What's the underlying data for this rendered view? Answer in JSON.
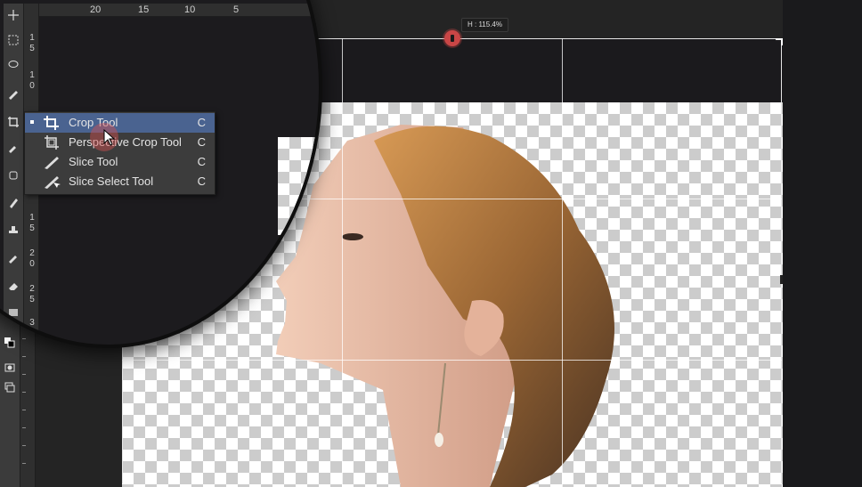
{
  "colors": {
    "menu_highlight": "#4a6390",
    "drag_handle": "#c94646"
  },
  "tools": [
    {
      "name": "move-tool-icon"
    },
    {
      "name": "marquee-tool-icon"
    },
    {
      "name": "lasso-tool-icon"
    },
    {
      "name": "brush-tool-icon"
    },
    {
      "name": "crop-tool-icon"
    },
    {
      "name": "eyedropper-tool-icon"
    },
    {
      "name": "healing-tool-icon"
    },
    {
      "name": "pen-tool-icon"
    },
    {
      "name": "stamp-tool-icon"
    },
    {
      "name": "history-brush-tool-icon"
    },
    {
      "name": "eraser-tool-icon"
    },
    {
      "name": "gradient-tool-icon"
    }
  ],
  "ruler": {
    "horizontal": [
      "20",
      "15",
      "10",
      "5"
    ],
    "vertical": [
      "1",
      "5",
      "1",
      "0",
      "1",
      "5",
      "2",
      "0",
      "2",
      "5",
      "3",
      "0"
    ]
  },
  "transform_readout": "H : 115.4%",
  "flyout": {
    "items": [
      {
        "label": "Crop Tool",
        "shortcut": "C",
        "icon": "crop-icon",
        "selected": true
      },
      {
        "label": "Perspective Crop Tool",
        "shortcut": "C",
        "icon": "perspective-crop-icon",
        "selected": false
      },
      {
        "label": "Slice Tool",
        "shortcut": "C",
        "icon": "slice-icon",
        "selected": false
      },
      {
        "label": "Slice Select Tool",
        "shortcut": "C",
        "icon": "slice-select-icon",
        "selected": false
      }
    ]
  }
}
